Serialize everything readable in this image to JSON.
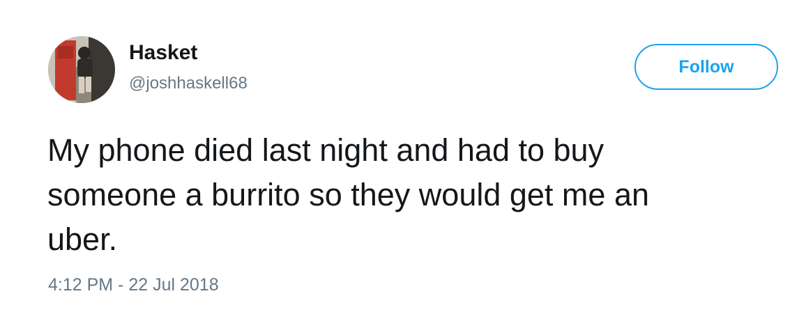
{
  "user": {
    "display_name": "Hasket",
    "handle": "@joshhaskell68"
  },
  "follow_button": {
    "label": "Follow"
  },
  "tweet": {
    "text": "My phone died last night and had to buy\nsomeone a burrito so they would get me an\nuber.",
    "timestamp": "4:12 PM - 22 Jul 2018"
  },
  "colors": {
    "accent": "#1da1f2",
    "text_primary": "#14171a",
    "text_secondary": "#657786",
    "background": "#ffffff"
  },
  "icons": {
    "avatar": "profile-photo"
  }
}
